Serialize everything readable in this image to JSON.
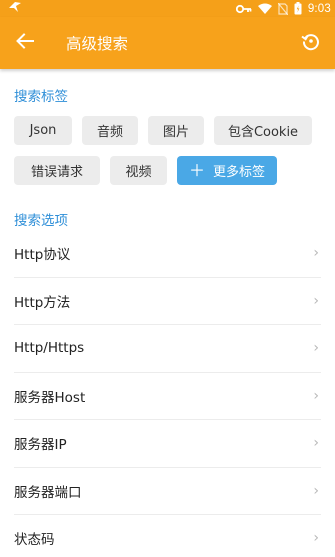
{
  "status_bar": {
    "time": "9:03",
    "icons": [
      "app-notification-icon",
      "key-icon",
      "wifi-icon",
      "no-sim-icon",
      "battery-icon"
    ]
  },
  "app_bar": {
    "title": "高级搜索",
    "back_icon": "arrow-left-icon",
    "history_icon": "history-icon"
  },
  "tags_section": {
    "title": "搜索标签",
    "rows": [
      [
        "Json",
        "音频",
        "图片",
        "包含Cookie"
      ],
      [
        "错误请求",
        "视频"
      ]
    ],
    "more_label": "更多标签",
    "more_icon": "plus-icon"
  },
  "options_section": {
    "title": "搜索选项",
    "items": [
      "Http协议",
      "Http方法",
      "Http/Https",
      "服务器Host",
      "服务器IP",
      "服务器端口",
      "状态码"
    ]
  },
  "colors": {
    "app_bar": "#f7a21b",
    "status_bar": "#f5a019",
    "section_title": "#2f8fd8",
    "more_button": "#4aa8e6",
    "tag_bg": "#ececec"
  }
}
